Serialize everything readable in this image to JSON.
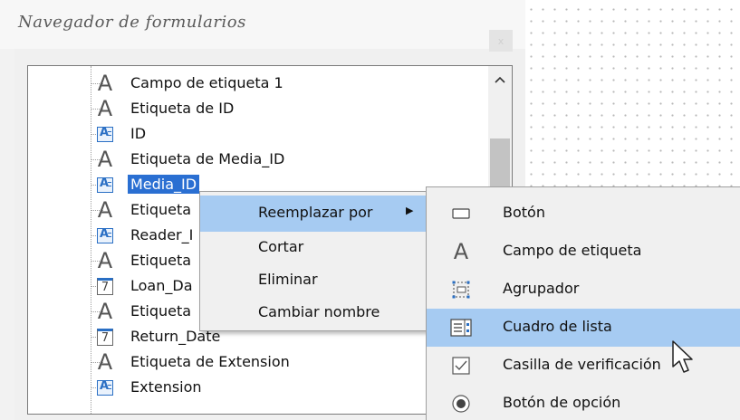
{
  "window": {
    "title": "Navegador de formularios",
    "close_label": "x"
  },
  "tree": {
    "items": [
      {
        "icon": "label",
        "label": "Campo de etiqueta 1"
      },
      {
        "icon": "field",
        "label": "Etiqueta de ID"
      },
      {
        "icon": "field",
        "label": "ID"
      },
      {
        "icon": "label",
        "label": "Etiqueta de Media_ID"
      },
      {
        "icon": "field",
        "label": "Media_ID"
      },
      {
        "icon": "label",
        "label": "Etiqueta"
      },
      {
        "icon": "field",
        "label": "Reader_I"
      },
      {
        "icon": "label",
        "label": "Etiqueta"
      },
      {
        "icon": "date",
        "label": "Loan_Da"
      },
      {
        "icon": "label",
        "label": "Etiqueta"
      },
      {
        "icon": "date",
        "label": "Return_Date"
      },
      {
        "icon": "label",
        "label": "Etiqueta de Extension"
      },
      {
        "icon": "field",
        "label": "Extension"
      }
    ],
    "icon_glyph_label": "A",
    "icon_glyph_date": "7"
  },
  "context_menu": {
    "items": [
      {
        "label": "Reemplazar por",
        "submenu_arrow": "▶"
      },
      {
        "label": "Cortar"
      },
      {
        "label": "Eliminar"
      },
      {
        "label": "Cambiar nombre"
      }
    ]
  },
  "submenu": {
    "items": [
      {
        "icon": "button-icon",
        "label": "Botón"
      },
      {
        "icon": "label-field-icon",
        "label": "Campo de etiqueta"
      },
      {
        "icon": "group-box-icon",
        "label": "Agrupador"
      },
      {
        "icon": "list-box-icon",
        "label": "Cuadro de lista"
      },
      {
        "icon": "checkbox-icon",
        "label": "Casilla de verificación"
      },
      {
        "icon": "radio-button-icon",
        "label": "Botón de opción"
      }
    ]
  },
  "colors": {
    "selection": "#2a6fd2",
    "menu_highlight": "#a6cbf2",
    "field_icon_blue": "#2a6fc4"
  }
}
